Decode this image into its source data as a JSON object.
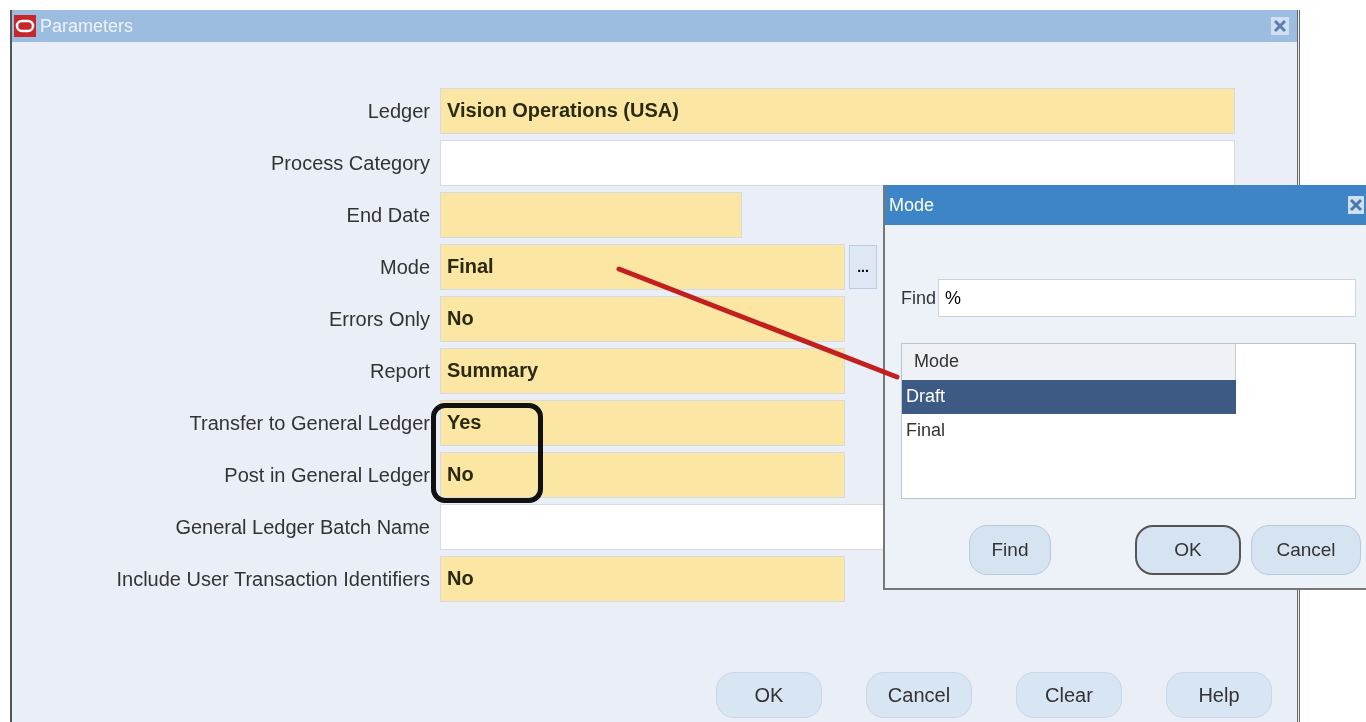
{
  "window": {
    "title": "Parameters"
  },
  "fields": [
    {
      "label": "Ledger",
      "value": "Vision Operations (USA)",
      "required": true,
      "kind": "long"
    },
    {
      "label": "Process Category",
      "required": false,
      "kind": "long"
    },
    {
      "label": "End Date",
      "required": true,
      "kind": "short"
    },
    {
      "label": "Mode",
      "value": "Final",
      "required": true,
      "kind": "medium",
      "lov_button": "..."
    },
    {
      "label": "Errors Only",
      "value": "No",
      "required": true,
      "kind": "medium"
    },
    {
      "label": "Report",
      "value": "Summary",
      "required": true,
      "kind": "medium"
    },
    {
      "label": "Transfer to General Ledger",
      "value": "Yes",
      "required": true,
      "kind": "medium"
    },
    {
      "label": "Post in General Ledger",
      "value": "No",
      "required": true,
      "kind": "medium"
    },
    {
      "label": "General Ledger Batch Name",
      "required": false,
      "kind": "long"
    },
    {
      "label": "Include User Transaction Identifiers",
      "value": "No",
      "required": true,
      "kind": "medium"
    }
  ],
  "buttons": [
    {
      "label": "OK"
    },
    {
      "label": "Cancel"
    },
    {
      "label": "Clear"
    },
    {
      "label": "Help"
    }
  ],
  "dialog": {
    "title": "Mode",
    "find_label": "Find",
    "find_value": "%",
    "column": "Mode",
    "rows": [
      {
        "label": "Draft",
        "selected": true
      },
      {
        "label": "Final",
        "selected": false
      }
    ],
    "buttons": [
      {
        "label": "Find",
        "default": false
      },
      {
        "label": "OK",
        "default": true
      },
      {
        "label": "Cancel",
        "default": false
      }
    ]
  },
  "annotations": [
    {
      "kind": "line"
    },
    {
      "kind": "box"
    }
  ]
}
